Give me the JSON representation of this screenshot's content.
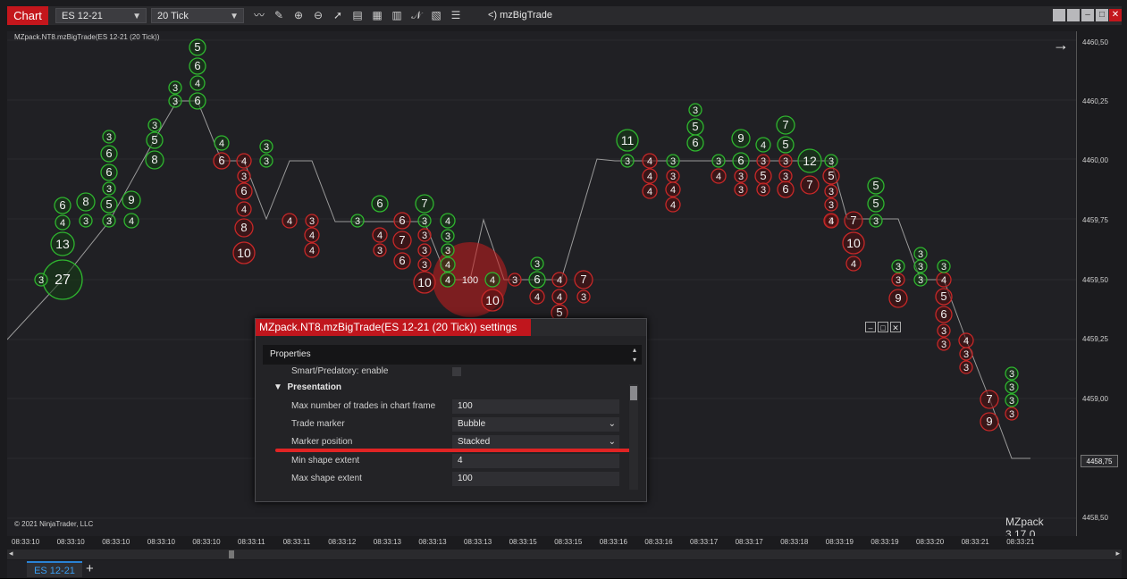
{
  "toolbar": {
    "chart_label": "Chart",
    "instrument": "ES 12-21",
    "interval": "20 Tick",
    "indicator_label": "<) mzBigTrade"
  },
  "chart": {
    "title": "MZpack.NT8.mzBigTrade(ES 12-21 (20 Tick))",
    "copyright": "© 2021 NinjaTrader, LLC",
    "brand": "MZpack 3.17.0",
    "price_ticks": [
      "4460,50",
      "4460,25",
      "4460,00",
      "4459,75",
      "4459,50",
      "4459,25",
      "4459,00",
      "4458,75",
      "4458,50"
    ],
    "last_price": "4458,75",
    "time_ticks": [
      "08:33:10",
      "08:33:10",
      "08:33:10",
      "08:33:10",
      "08:33:10",
      "08:33:11",
      "08:33:11",
      "08:33:12",
      "08:33:13",
      "08:33:13",
      "08:33:13",
      "08:33:15",
      "08:33:15",
      "08:33:16",
      "08:33:16",
      "08:33:17",
      "08:33:17",
      "08:33:18",
      "08:33:19",
      "08:33:19",
      "08:33:20",
      "08:33:21",
      "08:33:21"
    ],
    "colors": {
      "buy": "#2fb52f",
      "sell": "#c62828",
      "price_line": "#9a9a9a",
      "background": "#202024"
    }
  },
  "tabs": {
    "active": "ES 12-21",
    "add": "+"
  },
  "dialog": {
    "title": "MZpack.NT8.mzBigTrade(ES 12-21 (20 Tick)) settings",
    "properties_label": "Properties",
    "partial_row": "Smart/Predatory: enable",
    "section": "Presentation",
    "rows": [
      {
        "label": "Max number of trades in chart frame",
        "value": "100"
      },
      {
        "label": "Trade marker",
        "value": "Bubble"
      },
      {
        "label": "Marker position",
        "value": "Stacked"
      },
      {
        "label": "Min shape extent",
        "value": "4"
      },
      {
        "label": "Max shape extent",
        "value": "100"
      }
    ]
  },
  "markers": {
    "buy": [
      [
        "5",
        213,
        53
      ],
      [
        "6",
        213,
        74
      ],
      [
        "4",
        213,
        93
      ],
      [
        "3",
        188,
        98
      ],
      [
        "6",
        213,
        113
      ],
      [
        "3",
        188,
        113
      ],
      [
        "3",
        165,
        140
      ],
      [
        "5",
        165,
        157
      ],
      [
        "8",
        165,
        179
      ],
      [
        "3",
        114,
        153
      ],
      [
        "6",
        114,
        172
      ],
      [
        "6",
        114,
        193
      ],
      [
        "3",
        114,
        211
      ],
      [
        "5",
        114,
        229
      ],
      [
        "3",
        114,
        247
      ],
      [
        "9",
        139,
        224
      ],
      [
        "4",
        139,
        247
      ],
      [
        "8",
        88,
        226
      ],
      [
        "3",
        88,
        247
      ],
      [
        "6",
        62,
        230
      ],
      [
        "4",
        62,
        249
      ],
      [
        "13",
        62,
        273
      ],
      [
        "27",
        62,
        313
      ],
      [
        "3",
        38,
        313
      ],
      [
        "4",
        240,
        160
      ],
      [
        "3",
        290,
        164
      ],
      [
        "3",
        290,
        180
      ],
      [
        "3",
        392,
        247
      ],
      [
        "6",
        417,
        228
      ],
      [
        "7",
        467,
        228
      ],
      [
        "3",
        467,
        247
      ],
      [
        "4",
        493,
        247
      ],
      [
        "3",
        493,
        264
      ],
      [
        "3",
        493,
        280
      ],
      [
        "4",
        493,
        296
      ],
      [
        "4",
        493,
        313
      ],
      [
        "4",
        543,
        313
      ],
      [
        "3",
        593,
        295
      ],
      [
        "6",
        593,
        313
      ],
      [
        "11",
        694,
        157
      ],
      [
        "3",
        694,
        180
      ],
      [
        "3",
        745,
        180
      ],
      [
        "3",
        770,
        123
      ],
      [
        "5",
        770,
        142
      ],
      [
        "6",
        770,
        160
      ],
      [
        "3",
        796,
        180
      ],
      [
        "9",
        821,
        155
      ],
      [
        "6",
        821,
        180
      ],
      [
        "4",
        846,
        162
      ],
      [
        "7",
        871,
        140
      ],
      [
        "5",
        871,
        162
      ],
      [
        "12",
        898,
        180
      ],
      [
        "3",
        922,
        180
      ],
      [
        "5",
        972,
        208
      ],
      [
        "5",
        972,
        228
      ],
      [
        "3",
        972,
        247
      ],
      [
        "3",
        997,
        298
      ],
      [
        "3",
        1022,
        284
      ],
      [
        "3",
        1022,
        298
      ],
      [
        "3",
        1022,
        313
      ],
      [
        "3",
        1048,
        298
      ],
      [
        "3",
        1124,
        418
      ],
      [
        "3",
        1124,
        433
      ],
      [
        "3",
        1124,
        448
      ]
    ],
    "sell": [
      [
        "6",
        240,
        180
      ],
      [
        "4",
        265,
        180
      ],
      [
        "3",
        265,
        197
      ],
      [
        "6",
        265,
        214
      ],
      [
        "4",
        265,
        234
      ],
      [
        "8",
        265,
        255
      ],
      [
        "10",
        265,
        283
      ],
      [
        "4",
        316,
        247
      ],
      [
        "3",
        341,
        247
      ],
      [
        "4",
        341,
        263
      ],
      [
        "4",
        341,
        280
      ],
      [
        "6",
        442,
        247
      ],
      [
        "7",
        442,
        269
      ],
      [
        "6",
        442,
        292
      ],
      [
        "4",
        417,
        263
      ],
      [
        "3",
        417,
        280
      ],
      [
        "3",
        467,
        263
      ],
      [
        "3",
        467,
        280
      ],
      [
        "3",
        467,
        296
      ],
      [
        "10",
        467,
        316
      ],
      [
        "4",
        493,
        313
      ],
      [
        "100",
        518,
        313
      ],
      [
        "10",
        543,
        336
      ],
      [
        "3",
        568,
        313
      ],
      [
        "4",
        618,
        313
      ],
      [
        "7",
        645,
        313
      ],
      [
        "4",
        593,
        332
      ],
      [
        "4",
        618,
        332
      ],
      [
        "3",
        645,
        332
      ],
      [
        "5",
        618,
        350
      ],
      [
        "4",
        719,
        180
      ],
      [
        "4",
        719,
        197
      ],
      [
        "4",
        719,
        214
      ],
      [
        "3",
        745,
        197
      ],
      [
        "4",
        745,
        212
      ],
      [
        "4",
        745,
        229
      ],
      [
        "4",
        796,
        197
      ],
      [
        "3",
        821,
        197
      ],
      [
        "3",
        821,
        212
      ],
      [
        "3",
        846,
        180
      ],
      [
        "5",
        846,
        197
      ],
      [
        "3",
        846,
        212
      ],
      [
        "3",
        871,
        180
      ],
      [
        "3",
        871,
        197
      ],
      [
        "6",
        871,
        212
      ],
      [
        "7",
        898,
        207
      ],
      [
        "5",
        922,
        197
      ],
      [
        "3",
        922,
        214
      ],
      [
        "3",
        922,
        229
      ],
      [
        "3",
        922,
        247
      ],
      [
        "4",
        922,
        247
      ],
      [
        "7",
        947,
        247
      ],
      [
        "10",
        947,
        272
      ],
      [
        "4",
        947,
        295
      ],
      [
        "3",
        997,
        313
      ],
      [
        "9",
        997,
        334
      ],
      [
        "4",
        1048,
        313
      ],
      [
        "5",
        1048,
        332
      ],
      [
        "6",
        1048,
        352
      ],
      [
        "3",
        1048,
        370
      ],
      [
        "3",
        1048,
        385
      ],
      [
        "4",
        1073,
        381
      ],
      [
        "3",
        1073,
        396
      ],
      [
        "3",
        1073,
        411
      ],
      [
        "7",
        1099,
        447
      ],
      [
        "9",
        1099,
        472
      ],
      [
        "3",
        1124,
        463
      ]
    ]
  }
}
